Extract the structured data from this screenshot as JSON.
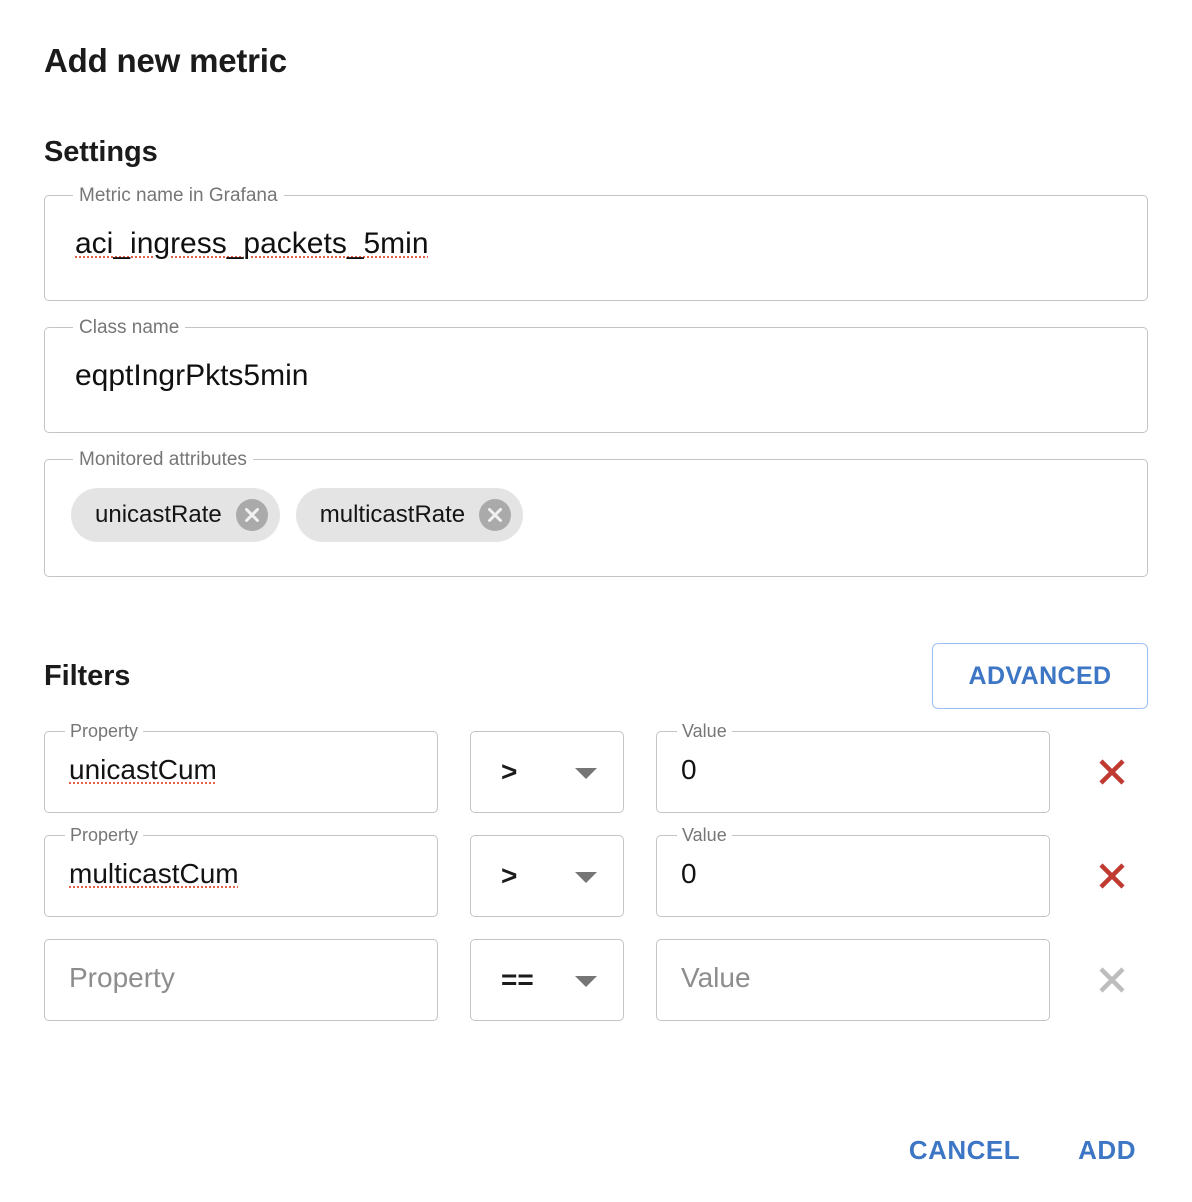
{
  "dialog": {
    "title": "Add new metric"
  },
  "settings": {
    "title": "Settings",
    "metric_name": {
      "label": "Metric name in Grafana",
      "value": "aci_ingress_packets_5min"
    },
    "class_name": {
      "label": "Class name",
      "value": "eqptIngrPkts5min"
    },
    "monitored_attributes": {
      "label": "Monitored attributes",
      "chips": [
        {
          "label": "unicastRate",
          "remove_icon": "chip-close-icon"
        },
        {
          "label": "multicastRate",
          "remove_icon": "chip-close-icon"
        }
      ]
    }
  },
  "filters": {
    "title": "Filters",
    "advanced_label": "ADVANCED",
    "property_label": "Property",
    "value_label": "Value",
    "property_placeholder": "Property",
    "value_placeholder": "Value",
    "rows": [
      {
        "property": "unicastCum",
        "operator": "&gt;",
        "value": "0",
        "delete_icon": "close-icon",
        "delete_enabled": true
      },
      {
        "property": "multicastCum",
        "operator": "&gt;",
        "value": "0",
        "delete_icon": "close-icon",
        "delete_enabled": true
      },
      {
        "property": "",
        "operator": "==",
        "value": "",
        "delete_icon": "close-icon",
        "delete_enabled": false
      }
    ]
  },
  "footer": {
    "cancel_label": "CANCEL",
    "add_label": "ADD"
  },
  "colors": {
    "accent_blue": "#3c76c4",
    "advanced_border": "#9dc0ec",
    "delete_red": "#bf3a30",
    "delete_disabled": "#bdbdbd",
    "field_border": "#c4c4c4",
    "label_gray": "#767676",
    "chip_bg": "#e4e4e4",
    "chip_x_bg": "#aaaaaa",
    "spellcheck_red": "#e8604c"
  }
}
